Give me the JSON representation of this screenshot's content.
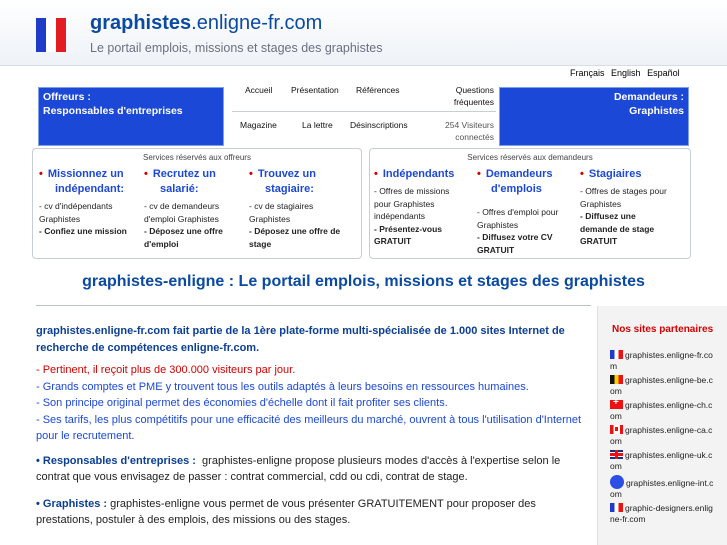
{
  "header": {
    "site_name_bold": "graphistes",
    "site_name_rest": ".enligne-fr.com",
    "tagline": "Le portail emplois, missions et stages des graphistes",
    "flag_colors": [
      "#1f3cc8",
      "#ffffff",
      "#e31b23"
    ]
  },
  "languages": [
    "Français",
    "English",
    "Español"
  ],
  "left_box": {
    "line1": "Offreurs :",
    "line2": "Responsables d'entreprises"
  },
  "right_box": {
    "line1": "Demandeurs :",
    "line2": "Graphistes"
  },
  "menu": {
    "accueil": "Accueil",
    "presentation": "Présentation",
    "references": "Références",
    "questions1": "Questions",
    "questions2": "fréquentes",
    "magazine": "Magazine",
    "lettre": "La lettre",
    "desinscriptions": "Désinscriptions",
    "visitors1": "254 Visiteurs",
    "visitors2": "connectés"
  },
  "offreurs_panel": {
    "title": "Services réservés aux offreurs",
    "columns": [
      {
        "head": [
          "Missionnez un",
          "indépendant:"
        ],
        "lines": [
          "- cv d'indépendants",
          "Graphistes"
        ],
        "bold": [
          "- Confiez une mission"
        ]
      },
      {
        "head": [
          "Recrutez un",
          "salarié:"
        ],
        "lines": [
          "- cv de demandeurs",
          "d'emploi Graphistes"
        ],
        "bold": [
          "- Déposez une offre",
          "d'emploi"
        ]
      },
      {
        "head": [
          "Trouvez un",
          "stagiaire:"
        ],
        "lines": [
          "- cv de stagiaires",
          "Graphistes"
        ],
        "bold": [
          "- Déposez une offre de",
          "stage"
        ]
      }
    ]
  },
  "demandeurs_panel": {
    "title": "Services réservés aux demandeurs",
    "columns": [
      {
        "head": [
          "Indépendants"
        ],
        "lines": [
          "- Offres de missions",
          "pour Graphistes",
          "indépendants"
        ],
        "bold": [
          "- Présentez-vous",
          "GRATUIT"
        ]
      },
      {
        "head": [
          "Demandeurs",
          "d'emplois"
        ],
        "lines": [
          "- Offres d'emploi pour",
          "Graphistes"
        ],
        "bold": [
          "- Diffusez votre CV",
          "GRATUIT"
        ]
      },
      {
        "head": [
          "Stagiaires"
        ],
        "lines": [
          "- Offres de stages pour",
          "Graphistes"
        ],
        "bold": [
          "- Diffusez une",
          "demande de stage",
          "GRATUIT"
        ]
      }
    ]
  },
  "main": {
    "title": "graphistes-enligne : Le portail emplois, missions et stages des graphistes",
    "intro": "graphistes.enligne-fr.com fait partie de la 1ère plate-forme multi-spécialisée de 1.000 sites Internet de recherche de compétences enligne-fr.com.",
    "points": [
      "- Pertinent, il reçoit plus de 300.000 visiteurs par jour.",
      "- Grands comptes et PME y trouvent tous les outils adaptés à leurs besoins en ressources humaines.",
      "- Son principe original permet des économies d'échelle dont il fait profiter ses clients.",
      "- Ses tarifs, les plus compétitifs pour une efficacité des meilleurs du marché, ouvrent à tous l'utilisation d'Internet pour le recrutement."
    ],
    "resp_label": "• Responsables d'entreprises :",
    "resp_text": "graphistes-enligne propose plusieurs modes d'accès à l'expertise selon le contrat que vous envisagez de passer : contrat commercial, cdd ou cdi, contrat de stage.",
    "graph_label": "• Graphistes :",
    "graph_text": "graphistes-enligne vous permet de vous présenter GRATUITEMENT pour proposer des prestations, postuler à des emplois, des missions ou des stages."
  },
  "sidebar": {
    "title": "Nos sites partenaires",
    "partners": [
      {
        "flag": "fr",
        "label": "graphistes.enligne-fr.com"
      },
      {
        "flag": "be",
        "label": "graphistes.enligne-be.com"
      },
      {
        "flag": "ch",
        "label": "graphistes.enligne-ch.com"
      },
      {
        "flag": "ca",
        "label": "graphistes.enligne-ca.com"
      },
      {
        "flag": "uk",
        "label": "graphistes.enligne-uk.com"
      },
      {
        "flag": "globe",
        "label": "graphistes.enligne-int.com"
      },
      {
        "flag": "fr",
        "label": "graphic-designers.enligne-fr.com"
      }
    ]
  }
}
